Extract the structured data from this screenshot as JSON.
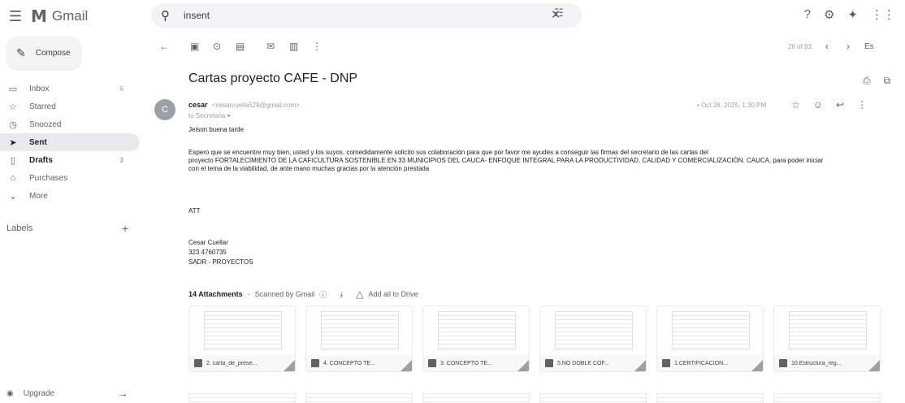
{
  "app": {
    "name": "Gmail"
  },
  "search": {
    "query": "insent"
  },
  "sidebar": {
    "compose_label": "Compose",
    "items": [
      {
        "label": "Inbox",
        "count": "6"
      },
      {
        "label": "Starred",
        "count": ""
      },
      {
        "label": "Snoozed",
        "count": ""
      },
      {
        "label": "Sent",
        "count": ""
      },
      {
        "label": "Drafts",
        "count": "3"
      },
      {
        "label": "Purchases",
        "count": ""
      },
      {
        "label": "More",
        "count": ""
      }
    ],
    "labels_heading": "Labels",
    "upgrade_label": "Upgrade"
  },
  "toolbar": {
    "pager": "26 of 93",
    "lang": "Es"
  },
  "email": {
    "subject": "Cartas proyecto CAFE - DNP",
    "avatar_letter": "C",
    "sender_name": "cesar",
    "sender_email": "<cesarcuella529@gmail.com>",
    "to": "to Secretaria",
    "date": "Oct 28, 2025, 1:30 PM",
    "greeting": "Jeison buena tarde",
    "body_line1": "Espero que se encuentre muy bien, usted y los suyos, comedidamente solicito sus colaboración para que por favor me ayudes a conseguir las firmas del secretario de las cartas del",
    "body_line2": "proyecto FORTALECIMIENTO DE LA CAFICULTURA SOSTENIBLE EN 33 MUNICIPIOS DEL CAUCA- ENFOQUE INTEGRAL PARA LA PRODUCTIVIDAD, CALIDAD Y COMERCIALIZACIÓN. CAUCA, para poder iniciar",
    "body_line3": "con el tema de la viabilidad, de ante mano muchas gracias por la atención prestada",
    "att_text": "ATT",
    "sig_name": "Cesar Cuellar",
    "sig_phone": "323 4760735",
    "sig_dept": "SADR - PROYECTOS"
  },
  "attachments": {
    "count_label": "14 Attachments",
    "scanned_label": "Scanned by Gmail",
    "drive_label": "Add all to Drive",
    "files": [
      "2. carta_de_prese...",
      "4. CONCEPTO TE...",
      "3. CONCEPTO TÉ...",
      "5.NO DOBLE COF...",
      "1.CERTIFICACION...",
      "10.Estructura_reg..."
    ]
  }
}
